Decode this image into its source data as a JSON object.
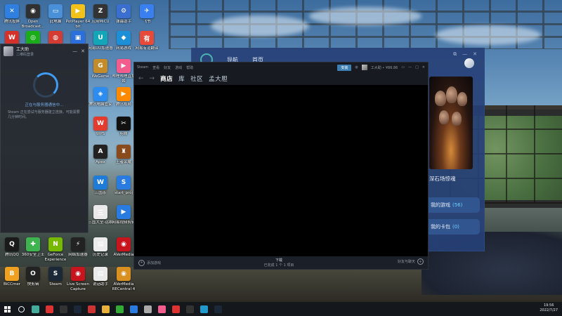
{
  "desktop_icons": [
    {
      "label": "腾讯投屏",
      "color": "#2f7fe0",
      "glyph": "✕"
    },
    {
      "label": "Open Broadcast...",
      "color": "#303030",
      "glyph": "◉"
    },
    {
      "label": "此电脑",
      "color": "#4a90d9",
      "glyph": "▭"
    },
    {
      "label": "PotPlayer 64 bit",
      "color": "#f2c21b",
      "glyph": "▶"
    },
    {
      "label": "应用MiCU",
      "color": "#333",
      "glyph": "Z"
    },
    {
      "label": "弹幕助手",
      "color": "#3a6fd0",
      "glyph": "⚙"
    },
    {
      "label": "飞书",
      "color": "#3a7ff0",
      "glyph": "✈"
    },
    {
      "label": "WPS Office",
      "color": "#d4312a",
      "glyph": "W"
    },
    {
      "label": "微信",
      "color": "#1aad19",
      "glyph": "◎"
    },
    {
      "label": "网易云音乐",
      "color": "#d43c33",
      "glyph": "◍"
    },
    {
      "label": "Wrtc",
      "color": "#2a6fdc",
      "glyph": "▣"
    },
    {
      "label": "网易UU加速器",
      "color": "#12a6b8",
      "glyph": "U"
    },
    {
      "label": "网易游戏",
      "color": "#1c8fd6",
      "glyph": "◆"
    },
    {
      "label": "网易有道翻译",
      "color": "#e84a3a",
      "glyph": "有"
    },
    {
      "label": "WeGame",
      "color": "#c38b2a",
      "glyph": "G"
    },
    {
      "label": "哔哩哔哩直播姬",
      "color": "#f25d8e",
      "glyph": "▶"
    },
    {
      "label": "腾讯电脑管家",
      "color": "#2d8cf0",
      "glyph": "◈"
    },
    {
      "label": "腾讯视频",
      "color": "#ff8a00",
      "glyph": "▶"
    },
    {
      "label": "WPS",
      "color": "#e33b2e",
      "glyph": "W"
    },
    {
      "label": "剪映",
      "color": "#111",
      "glyph": "✂"
    },
    {
      "label": "Apex",
      "color": "#222",
      "glyph": "A"
    },
    {
      "label": "王者荣耀",
      "color": "#8a4b1c",
      "glyph": "♜"
    },
    {
      "label": "三国杀",
      "color": "#1e7bd7",
      "glyph": "W"
    },
    {
      "label": "start_proj",
      "color": "#2a7be0",
      "glyph": "S"
    },
    {
      "label": "三国大全-运维",
      "color": "#eaeaea",
      "glyph": "三"
    },
    {
      "label": "网易视频剪辑",
      "color": "#2a7be0",
      "glyph": "▶"
    },
    {
      "label": "腾讯QQ",
      "color": "#1a1a1a",
      "glyph": "Q"
    },
    {
      "label": "360安全卫士",
      "color": "#3fb34f",
      "glyph": "✚"
    },
    {
      "label": "GeForce Experience",
      "color": "#76b900",
      "glyph": "N"
    },
    {
      "label": "网络加速器",
      "color": "#222",
      "glyph": "⚡"
    },
    {
      "label": "历史记录",
      "color": "#ececec",
      "glyph": "▤"
    },
    {
      "label": "AVerMedia",
      "color": "#c8141c",
      "glyph": "◉"
    },
    {
      "label": "BiCCmer",
      "color": "#f0a020",
      "glyph": "B"
    },
    {
      "label": "快剪辑",
      "color": "#222",
      "glyph": "O"
    },
    {
      "label": "Steam",
      "color": "#1b2838",
      "glyph": "S"
    },
    {
      "label": "Live Screen Capture",
      "color": "#c8141c",
      "glyph": "◉"
    },
    {
      "label": "说话助手",
      "color": "#eaeaea",
      "glyph": "▤"
    },
    {
      "label": "AVerMedia RECentral 4",
      "color": "#d89020",
      "glyph": "◉"
    }
  ],
  "login_window": {
    "username": "工大助",
    "subtitle": "二维码登录",
    "status": "正在与服务器通信中…",
    "hint": "Steam 正在尝试与服务器建立连接。可能需要几分钟时间。"
  },
  "friends_window": {
    "tabs": [
      "导航",
      "首页"
    ],
    "game_title": "深石场惊魂",
    "my_games_label": "我的游戏",
    "my_games_count": "(56)",
    "my_cards_label": "我的卡包",
    "my_cards_count": "(0)"
  },
  "steam_window": {
    "menu": [
      "Steam",
      "查看",
      "好友",
      "游戏",
      "帮助"
    ],
    "install_btn": "安装",
    "account": "工大助 • ¥86.86",
    "nav": {
      "back": "←",
      "forward": "→",
      "store": "商店",
      "library": "库",
      "community": "社区",
      "user": "孟大胆"
    },
    "footer": {
      "add_game": "添加游戏",
      "download_title": "下载",
      "download_sub": "已完成 1 个 1 项目",
      "friends_chat": "好友与聊天"
    }
  },
  "taskbar": {
    "time": "19:56",
    "date": "2022/7/27",
    "items": [
      "start",
      "search",
      "cortana",
      "chrome",
      "obs",
      "steam",
      "wps",
      "folder",
      "xbox",
      "edge",
      "user",
      "bilibili",
      "wps2",
      "game",
      "qq",
      "steam2"
    ]
  },
  "colors": {
    "accent": "#3d7fb3",
    "friends_bg": "#26407a",
    "login_spinner": "#3f9cf2"
  }
}
